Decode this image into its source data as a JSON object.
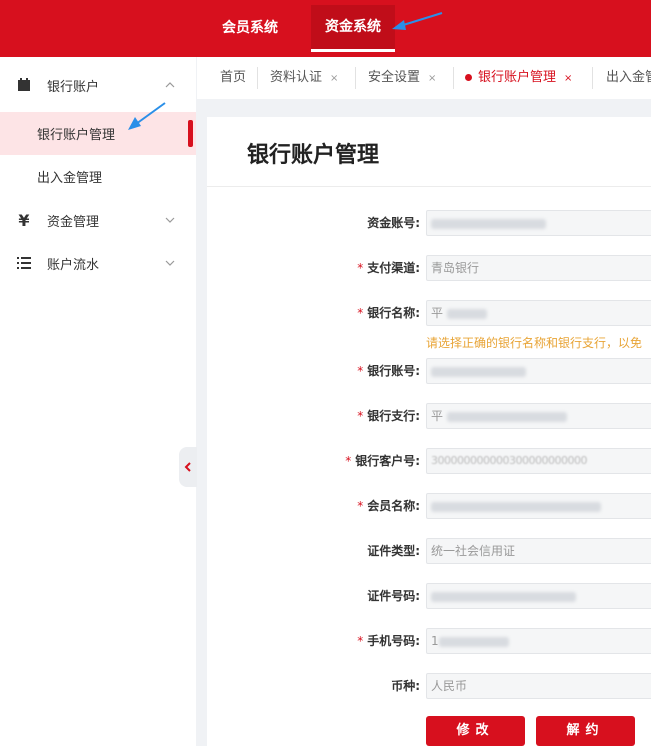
{
  "topnav": {
    "member_system": "会员系统",
    "fund_system": "资金系统"
  },
  "sidebar": {
    "bank_account": "银行账户",
    "bank_account_manage": "银行账户管理",
    "deposit_withdraw_manage": "出入金管理",
    "fund_manage": "资金管理",
    "account_flow": "账户流水",
    "fund_icon": "¥"
  },
  "tabs": {
    "home": "首页",
    "cert": "资料认证",
    "security": "安全设置",
    "bank_manage": "银行账户管理",
    "deposit": "出入金管",
    "close": "×"
  },
  "page": {
    "title": "银行账户管理"
  },
  "form": {
    "fund_account_label": "资金账号:",
    "pay_channel_label": "支付渠道:",
    "pay_channel_value": "青岛银行",
    "bank_name_label": "银行名称:",
    "bank_name_value": "平",
    "bank_hint": "请选择正确的银行名称和银行支行，以免",
    "bank_account_label": "银行账号:",
    "bank_branch_label": "银行支行:",
    "bank_branch_value": "平",
    "bank_customer_no_label": "银行客户号:",
    "bank_customer_no_value": "300000000000300000000000",
    "member_name_label": "会员名称:",
    "cert_type_label": "证件类型:",
    "cert_type_value": "统一社会信用证",
    "cert_no_label": "证件号码:",
    "phone_label": "手机号码:",
    "phone_value": "1",
    "currency_label": "币种:",
    "currency_value": "人民币",
    "required_mark": "*"
  },
  "buttons": {
    "modify": "修改",
    "unbind": "解约"
  },
  "colors": {
    "brand_red": "#d7101e",
    "active_bg": "#fde4e6",
    "hint_orange": "#e8a436",
    "annotation_blue": "#2a8fe8"
  }
}
